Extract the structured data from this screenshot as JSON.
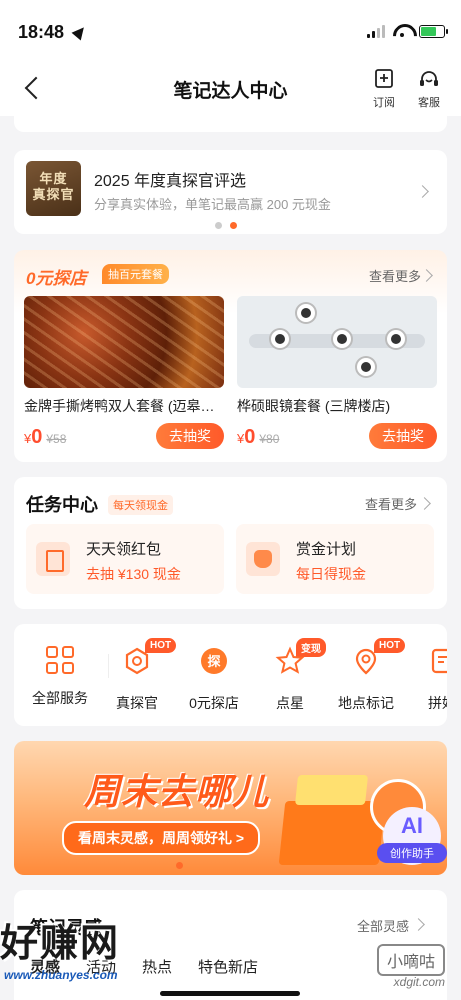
{
  "status": {
    "time": "18:48"
  },
  "nav": {
    "title": "笔记达人中心",
    "subscribe_label": "订阅",
    "service_label": "客服"
  },
  "selection": {
    "badge_line1": "年度",
    "badge_line2": "真探官",
    "title": "2025 年度真探官评选",
    "subtitle": "分享真实体验，单笔记最高赢 200 元现金"
  },
  "zero_explore": {
    "title": "0元探店",
    "tag": "抽百元套餐",
    "more": "查看更多",
    "deals": [
      {
        "name": "金牌手撕烤鸭双人套餐 (迈皋…",
        "currency": "¥",
        "price": "0",
        "old_price": "¥58",
        "button": "去抽奖"
      },
      {
        "name": "桦硕眼镜套餐 (三牌楼店)",
        "currency": "¥",
        "price": "0",
        "old_price": "¥80",
        "button": "去抽奖"
      }
    ]
  },
  "task_center": {
    "title": "任务中心",
    "tag": "每天领现金",
    "more": "查看更多",
    "items": [
      {
        "name": "天天领红包",
        "sub": "去抽 ¥130 现金"
      },
      {
        "name": "赏金计划",
        "sub": "每日得现金"
      }
    ]
  },
  "services": [
    {
      "label": "全部服务",
      "badge": "",
      "icon": "grid-icon"
    },
    {
      "label": "真探官",
      "badge": "HOT",
      "icon": "hexagon-icon"
    },
    {
      "label": "0元探店",
      "badge": "",
      "icon": "explore-icon"
    },
    {
      "label": "点星",
      "badge": "变现",
      "icon": "star-icon"
    },
    {
      "label": "地点标记",
      "badge": "HOT",
      "icon": "location-icon"
    },
    {
      "label": "拼好",
      "badge": "",
      "icon": "flag-icon"
    }
  ],
  "weekend": {
    "title": "周末去哪儿",
    "pill": "看周末灵感，周周领好礼 >",
    "ai_label": "AI",
    "ai_caption": "创作助手"
  },
  "notes": {
    "title": "笔记灵感",
    "more": "全部灵感",
    "tabs": [
      "灵感",
      "活动",
      "热点",
      "特色新店"
    ]
  },
  "watermark": {
    "left": "好赚网",
    "left_url": "www.zhuanyes.com",
    "right": "小嘀咕",
    "right_url": "xdgit.com"
  }
}
